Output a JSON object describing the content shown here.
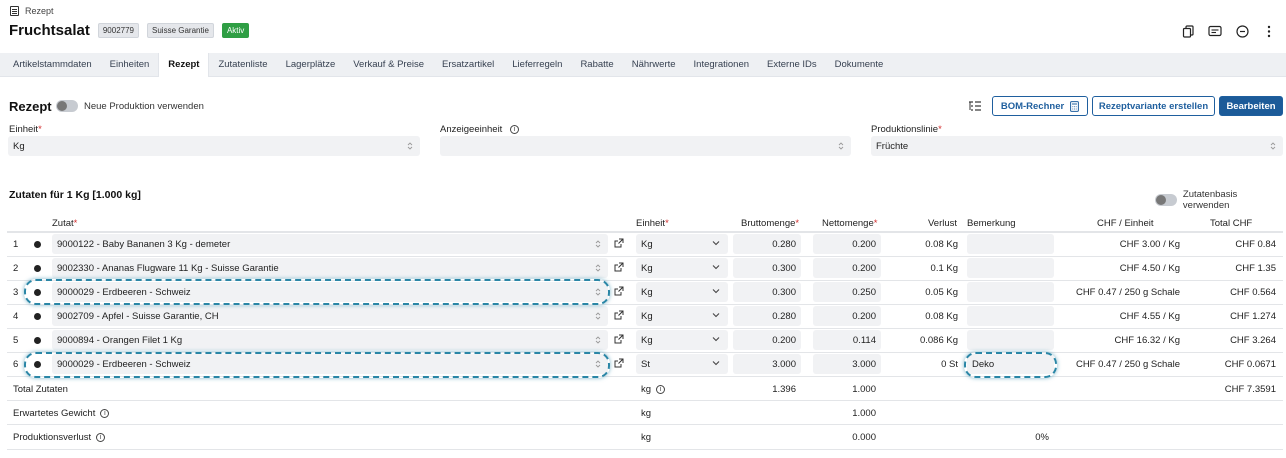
{
  "breadcrumb": "Rezept",
  "title": "Fruchtsalat",
  "badges": [
    "9002779",
    "Suisse Garantie",
    "Aktiv"
  ],
  "tabs": [
    "Artikelstammdaten",
    "Einheiten",
    "Rezept",
    "Zutatenliste",
    "Lagerplätze",
    "Verkauf & Preise",
    "Ersatzartikel",
    "Lieferregeln",
    "Rabatte",
    "Nährwerte",
    "Integrationen",
    "Externe IDs",
    "Dokumente"
  ],
  "active_tab": "Rezept",
  "section": {
    "title": "Rezept",
    "toggle_label": "Neue Produktion verwenden",
    "bom_button": "BOM-Rechner",
    "variant_button": "Rezeptvariante erstellen",
    "edit_button": "Bearbeiten"
  },
  "form": {
    "unit_label": "Einheit",
    "unit_value": "Kg",
    "display_unit_label": "Anzeigeeinheit",
    "display_unit_value": "",
    "production_line_label": "Produktionslinie",
    "production_line_value": "Früchte"
  },
  "ingredients": {
    "title": "Zutaten für 1 Kg [1.000 kg]",
    "toggle_label": "Zutatenbasis verwenden",
    "headers": {
      "ingredient": "Zutat",
      "unit": "Einheit",
      "gross": "Bruttomenge",
      "net": "Nettomenge",
      "loss": "Verlust",
      "remark": "Bemerkung",
      "price_per_unit": "CHF / Einheit",
      "total": "Total CHF"
    },
    "rows": [
      {
        "no": "1",
        "ingredient": "9000122 - Baby Bananen 3 Kg - demeter",
        "unit": "Kg",
        "gross": "0.280",
        "net": "0.200",
        "loss": "0.08 Kg",
        "remark": "",
        "price": "CHF 3.00 / Kg",
        "total": "CHF 0.84"
      },
      {
        "no": "2",
        "ingredient": "9002330 - Ananas Flugware 11 Kg - Suisse Garantie",
        "unit": "Kg",
        "gross": "0.300",
        "net": "0.200",
        "loss": "0.1 Kg",
        "remark": "",
        "price": "CHF 4.50 / Kg",
        "total": "CHF 1.35"
      },
      {
        "no": "3",
        "ingredient": "9000029 - Erdbeeren - Schweiz",
        "unit": "Kg",
        "gross": "0.300",
        "net": "0.250",
        "loss": "0.05 Kg",
        "remark": "",
        "price": "CHF 0.47 / 250 g Schale",
        "total": "CHF 0.564"
      },
      {
        "no": "4",
        "ingredient": "9002709 - Apfel - Suisse Garantie, CH",
        "unit": "Kg",
        "gross": "0.280",
        "net": "0.200",
        "loss": "0.08 Kg",
        "remark": "",
        "price": "CHF 4.55 / Kg",
        "total": "CHF 1.274"
      },
      {
        "no": "5",
        "ingredient": "9000894 - Orangen Filet 1 Kg",
        "unit": "Kg",
        "gross": "0.200",
        "net": "0.114",
        "loss": "0.086 Kg",
        "remark": "",
        "price": "CHF 16.32 / Kg",
        "total": "CHF 3.264"
      },
      {
        "no": "6",
        "ingredient": "9000029 - Erdbeeren - Schweiz",
        "unit": "St",
        "gross": "3.000",
        "net": "3.000",
        "loss": "0 St",
        "remark": "Deko",
        "price": "CHF 0.47 / 250 g Schale",
        "total": "CHF 0.0671"
      }
    ],
    "summary": {
      "total_label": "Total Zutaten",
      "total_unit": "kg",
      "total_gross": "1.396",
      "total_net": "1.000",
      "total_chf": "CHF 7.3591",
      "expected_label": "Erwartetes Gewicht",
      "expected_unit": "kg",
      "expected_net": "1.000",
      "loss_label": "Produktionsverlust",
      "loss_unit": "kg",
      "loss_net": "0.000",
      "loss_percent": "0%"
    }
  },
  "colors": {
    "primary": "#1c5b99",
    "active_badge": "#2f9e44",
    "highlight": "#2a86a6",
    "required": "#d32f2f"
  }
}
